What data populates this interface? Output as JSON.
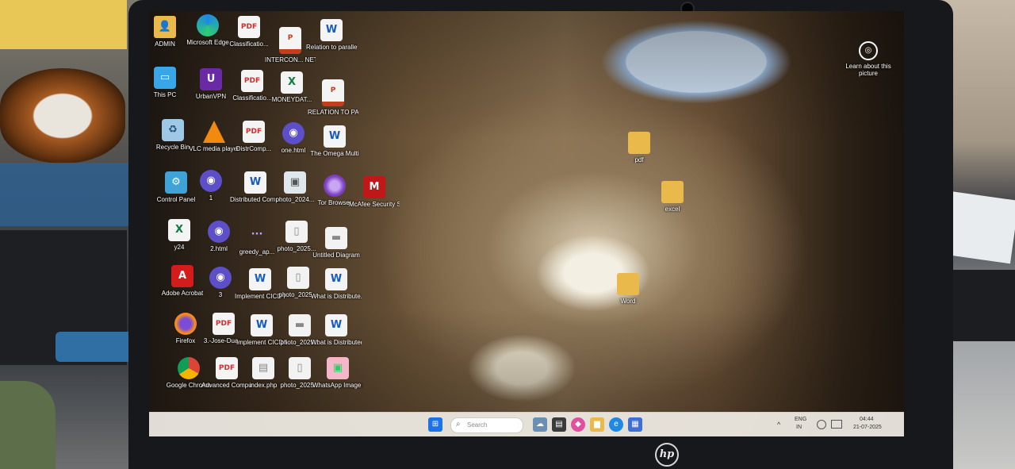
{
  "desktop": {
    "icons": [
      {
        "label": "ADMIN",
        "icon": "user-folder-icon",
        "glyph": "👤"
      },
      {
        "label": "Microsoft Edge",
        "icon": "edge-icon",
        "glyph": ""
      },
      {
        "label": "Classificatio...",
        "icon": "pdf-icon",
        "glyph": "PDF"
      },
      {
        "label": "INTERCON... NETWORKS",
        "icon": "powerpoint-icon",
        "glyph": "P"
      },
      {
        "label": "Relation to parallel mu...",
        "icon": "word-icon",
        "glyph": "W"
      },
      {
        "label": "This PC",
        "icon": "this-pc-icon",
        "glyph": "▭"
      },
      {
        "label": "UrbanVPN",
        "icon": "urbanvpn-icon",
        "glyph": "U"
      },
      {
        "label": "Classificatio...",
        "icon": "pdf-icon",
        "glyph": "PDF"
      },
      {
        "label": "MONEYDAT...",
        "icon": "excel-icon",
        "glyph": "X"
      },
      {
        "label": "RELATION TO PARALLEL ...",
        "icon": "powerpoint-icon",
        "glyph": "P"
      },
      {
        "label": "Recycle Bin",
        "icon": "recycle-bin-icon",
        "glyph": "♻"
      },
      {
        "label": "VLC media player",
        "icon": "vlc-icon",
        "glyph": ""
      },
      {
        "label": "DistrComp...",
        "icon": "pdf-icon",
        "glyph": "PDF"
      },
      {
        "label": "one.html",
        "icon": "html-file-icon",
        "glyph": "◉"
      },
      {
        "label": "The Omega Multi",
        "icon": "word-icon",
        "glyph": "W"
      },
      {
        "label": "Control Panel",
        "icon": "control-panel-icon",
        "glyph": "⚙"
      },
      {
        "label": "1",
        "icon": "html-file-icon",
        "glyph": "◉"
      },
      {
        "label": "Distributed Computing...",
        "icon": "word-icon",
        "glyph": "W"
      },
      {
        "label": "photo_2024...",
        "icon": "photo-icon",
        "glyph": "▣"
      },
      {
        "label": "Tor Browser",
        "icon": "tor-icon",
        "glyph": ""
      },
      {
        "label": "McAfee Security Sc...",
        "icon": "mcafee-icon",
        "glyph": "M"
      },
      {
        "label": "y24",
        "icon": "excel-icon",
        "glyph": "X"
      },
      {
        "label": "2.html",
        "icon": "html-file-icon",
        "glyph": "◉"
      },
      {
        "label": "greedy_ap...",
        "icon": "file-icon",
        "glyph": "···"
      },
      {
        "label": "photo_2025...",
        "icon": "photo-icon",
        "glyph": "▯"
      },
      {
        "label": "Untitled Diagram",
        "icon": "file-icon",
        "glyph": "▬"
      },
      {
        "label": "Adobe Acrobat",
        "icon": "acrobat-icon",
        "glyph": "A"
      },
      {
        "label": "3",
        "icon": "html-file-icon",
        "glyph": "◉"
      },
      {
        "label": "Implement CICD Pip...",
        "icon": "word-icon",
        "glyph": "W"
      },
      {
        "label": "photo_2025...",
        "icon": "photo-icon",
        "glyph": "▯"
      },
      {
        "label": "What is Distribute...",
        "icon": "word-icon",
        "glyph": "W"
      },
      {
        "label": "Firefox",
        "icon": "firefox-icon",
        "glyph": ""
      },
      {
        "label": "3.-Jose-Dua...",
        "icon": "pdf-icon",
        "glyph": "PDF"
      },
      {
        "label": "Implement CICD Pip...",
        "icon": "word-icon",
        "glyph": "W"
      },
      {
        "label": "photo_2025...",
        "icon": "photo-icon",
        "glyph": "▬"
      },
      {
        "label": "What is Distributed...",
        "icon": "word-icon",
        "glyph": "W"
      },
      {
        "label": "Google Chrome",
        "icon": "chrome-icon",
        "glyph": ""
      },
      {
        "label": "Advanced Computer ...",
        "icon": "pdf-icon",
        "glyph": "PDF"
      },
      {
        "label": "index.php",
        "icon": "php-file-icon",
        "glyph": "▤"
      },
      {
        "label": "photo_2025...",
        "icon": "photo-icon",
        "glyph": "▯"
      },
      {
        "label": "WhatsApp Image 202...",
        "icon": "whatsapp-image-icon",
        "glyph": "▣"
      },
      {
        "label": "pdf",
        "icon": "folder-icon",
        "glyph": ""
      },
      {
        "label": "excel",
        "icon": "folder-icon",
        "glyph": ""
      },
      {
        "label": "Word",
        "icon": "folder-icon",
        "glyph": ""
      }
    ],
    "learn_about": {
      "label": "Learn about this picture",
      "icon": "camera-info-icon",
      "glyph": "◎"
    }
  },
  "taskbar": {
    "start_glyph": "⊞",
    "search_glyph": "⌕",
    "search_placeholder": "Search",
    "widget_glyph": "☁",
    "taskview_glyph": "▤",
    "copilot_glyph": "◆",
    "files_glyph": "▆",
    "edge_glyph": "e",
    "store_glyph": "▦",
    "tray": {
      "chevron": "^",
      "lang_top": "ENG",
      "lang_bottom": "IN",
      "time": "04:44",
      "date": "21-07-2025"
    }
  },
  "brand": {
    "logo_text": "hp"
  }
}
